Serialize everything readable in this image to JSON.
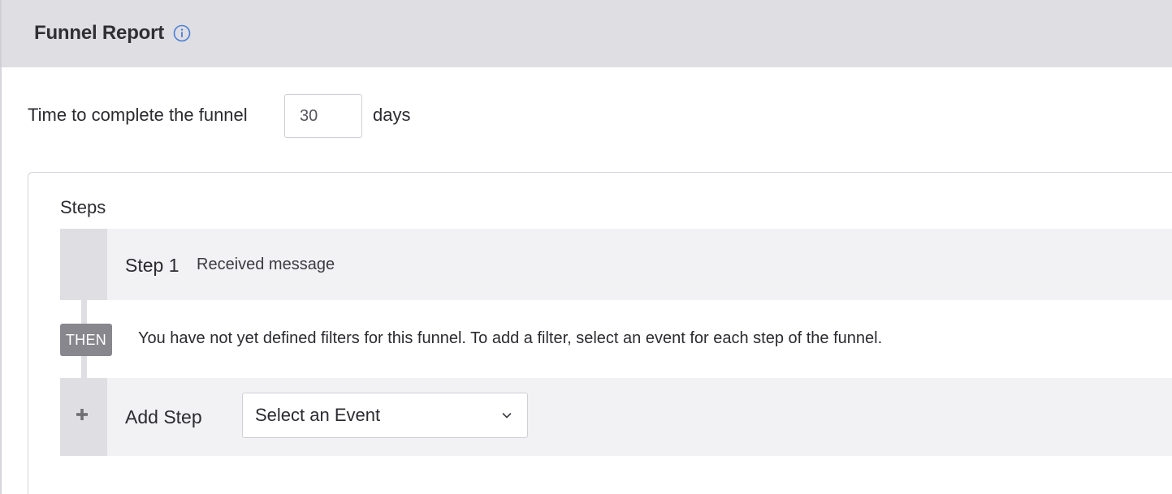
{
  "header": {
    "title": "Funnel Report",
    "info_icon": "info-circle-icon",
    "accent": "#4a7fd6"
  },
  "time_setting": {
    "label": "Time to complete the funnel",
    "value": "30",
    "unit": "days"
  },
  "steps": {
    "title": "Steps",
    "items": [
      {
        "label": "Step 1",
        "event": "Received message"
      }
    ],
    "connector_badge": "THEN",
    "empty_filters_message": "You have not yet defined filters for this funnel. To add a filter, select an event for each step of the funnel.",
    "add_step": {
      "icon": "plus-icon",
      "label": "Add Step",
      "select_value": "Select an Event",
      "select_icon": "chevron-down-icon"
    }
  }
}
